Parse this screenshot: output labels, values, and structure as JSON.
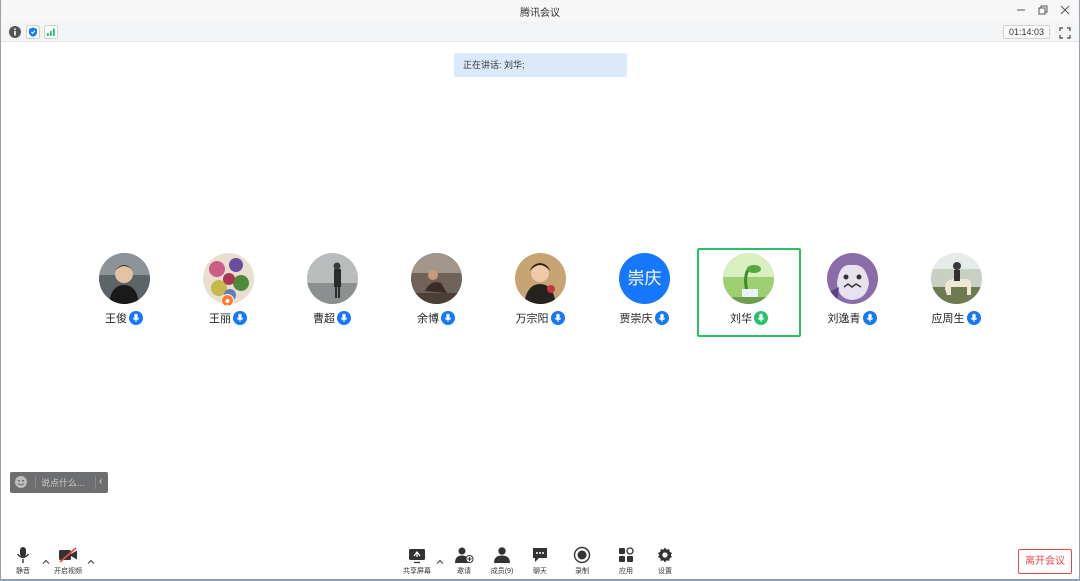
{
  "window": {
    "title": "腾讯会议",
    "controls": [
      "minimize-icon",
      "restore-icon",
      "close-icon"
    ]
  },
  "statusbar": {
    "icons": [
      "info-icon",
      "shield-icon",
      "signal-icon"
    ],
    "timer": "01:14:03"
  },
  "speaking": {
    "text": "正在讲话: 刘华;"
  },
  "participants": [
    {
      "name": "王俊",
      "mic": "on"
    },
    {
      "name": "王丽",
      "mic": "on",
      "host": true
    },
    {
      "name": "曹超",
      "mic": "on"
    },
    {
      "name": "余博",
      "mic": "on"
    },
    {
      "name": "万宗阳",
      "mic": "on"
    },
    {
      "name": "贾崇庆",
      "mic": "on",
      "avatar_text": "崇庆"
    },
    {
      "name": "刘华",
      "mic": "speaking",
      "active": true
    },
    {
      "name": "刘逸青",
      "mic": "on"
    },
    {
      "name": "应周生",
      "mic": "on"
    }
  ],
  "chat": {
    "placeholder": "说点什么...",
    "collapse_label": "‹"
  },
  "toolbar": {
    "mute": "静音",
    "video": "开启视频",
    "share": "共享屏幕",
    "invite": "邀请",
    "members": "成员(9)",
    "chat": "聊天",
    "record": "录制",
    "apps": "应用",
    "settings": "设置",
    "leave": "离开会议"
  },
  "colors": {
    "accent": "#1677ff",
    "speaking_green": "#28c167",
    "leave_red": "#e8484b",
    "banner": "#dce9fb"
  }
}
